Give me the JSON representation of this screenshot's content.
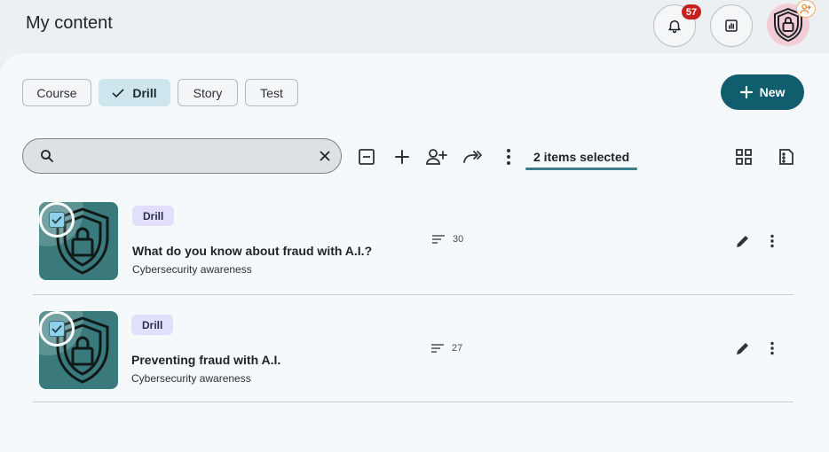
{
  "header": {
    "title": "My content",
    "notifications_count": "57"
  },
  "filters": {
    "chips": [
      {
        "label": "Course",
        "selected": false
      },
      {
        "label": "Drill",
        "selected": true
      },
      {
        "label": "Story",
        "selected": false
      },
      {
        "label": "Test",
        "selected": false
      }
    ]
  },
  "actions": {
    "new_label": "New"
  },
  "search": {
    "value": "",
    "placeholder": ""
  },
  "toolbar": {
    "selection_label": "2 items selected",
    "icons": [
      "collapse-icon",
      "add-icon",
      "add-person-icon",
      "forward-icon",
      "more-vert-icon",
      "grid-view-icon",
      "list-view-icon"
    ]
  },
  "items": [
    {
      "type": "Drill",
      "title": "What do you know about fraud with A.I.?",
      "subtitle": "Cybersecurity awareness",
      "count": "30",
      "checked": true
    },
    {
      "type": "Drill",
      "title": "Preventing fraud with A.I.",
      "subtitle": "Cybersecurity awareness",
      "count": "27",
      "checked": true
    }
  ],
  "colors": {
    "accent": "#0f5d6d",
    "selected_chip": "#cde5ec",
    "badge": "#c5221f",
    "thumbnail": "#3a7a7c",
    "type_pill": "#e1dff9"
  }
}
